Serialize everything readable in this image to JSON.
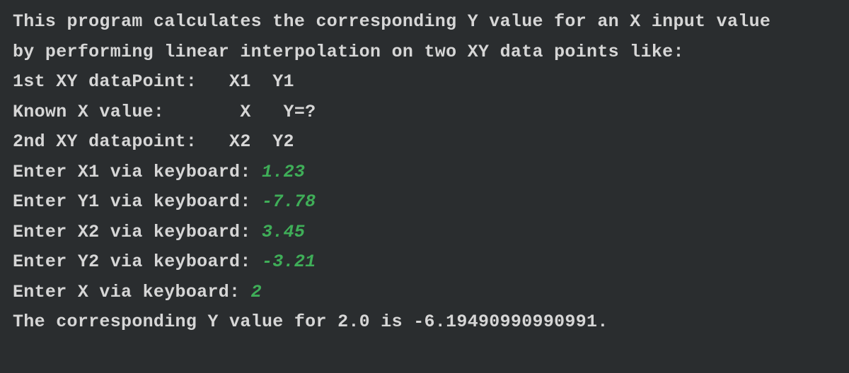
{
  "terminal": {
    "intro_line1": "This program calculates the corresponding Y value for an X input value",
    "intro_line2": "by performing linear interpolation on two XY data points like:",
    "schema_line1": "1st XY dataPoint:   X1  Y1",
    "schema_line2": "Known X value:       X   Y=?",
    "schema_line3": "2nd XY datapoint:   X2  Y2",
    "prompts": {
      "x1": "Enter X1 via keyboard: ",
      "y1": "Enter Y1 via keyboard: ",
      "x2": "Enter X2 via keyboard: ",
      "y2": "Enter Y2 via keyboard: ",
      "x": "Enter X via keyboard: "
    },
    "inputs": {
      "x1": "1.23",
      "y1": "-7.78",
      "x2": "3.45",
      "y2": "-3.21",
      "x": "2"
    },
    "result": "The corresponding Y value for 2.0 is -6.19490990990991."
  }
}
